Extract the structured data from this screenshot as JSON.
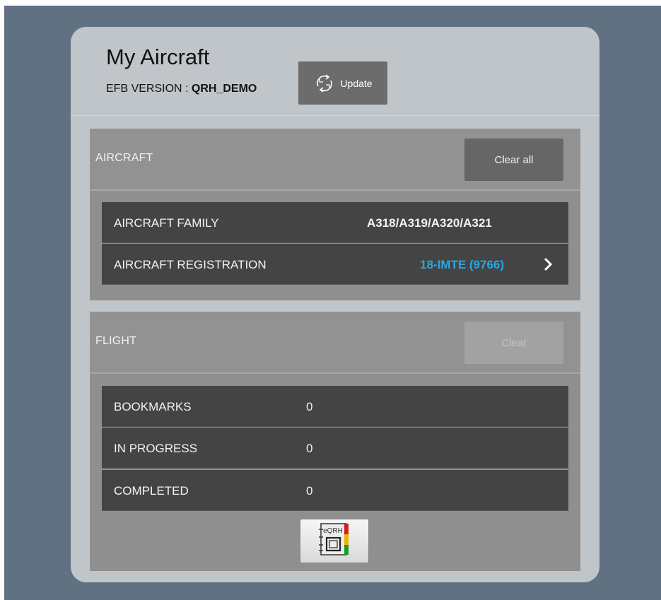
{
  "header": {
    "title": "My Aircraft",
    "version_label": "EFB VERSION : ",
    "version_value": "QRH_DEMO",
    "update_button": {
      "label": "Update",
      "icon": "sync-icon"
    }
  },
  "aircraft_section": {
    "title": "AIRCRAFT",
    "clear_button": "Clear all",
    "rows": [
      {
        "label": "AIRCRAFT FAMILY",
        "value": "A318/A319/A320/A321"
      },
      {
        "label": "AIRCRAFT REGISTRATION",
        "value": "18-IMTE (9766)",
        "icon": "chevron-right-icon"
      }
    ]
  },
  "flight_section": {
    "title": "FLIGHT",
    "clear_button": "Clear",
    "clear_disabled": true,
    "rows": [
      {
        "label": "BOOKMARKS",
        "value": "0"
      },
      {
        "label": "IN PROGRESS",
        "value": "0"
      },
      {
        "label": "COMPLETED",
        "value": "0"
      }
    ]
  },
  "eqrh_button": {
    "label": "eQRH",
    "icon": "eqrh-app-icon"
  },
  "colors": {
    "backdrop": "#607282",
    "card": "#c0c5ca",
    "row": "#444444",
    "link": "#27a7e6"
  }
}
